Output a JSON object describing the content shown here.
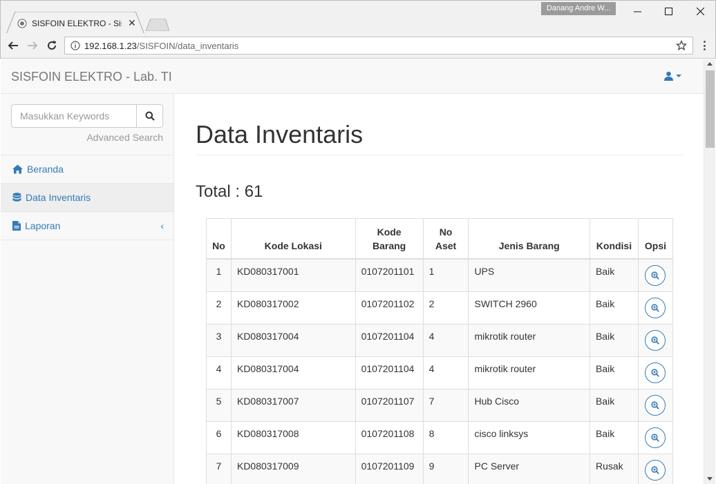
{
  "browser": {
    "tab_title": "SISFOIN ELEKTRO - Sistem",
    "user_badge": "Danang Andre W...",
    "url_host": "192.168.1.23",
    "url_path": "/SISFOIN/data_inventaris"
  },
  "navbar": {
    "brand": "SISFOIN ELEKTRO - Lab. TI"
  },
  "sidebar": {
    "search_placeholder": "Masukkan Keywords",
    "advanced_search": "Advanced Search",
    "items": [
      {
        "label": "Beranda",
        "icon": "home-icon"
      },
      {
        "label": "Data Inventaris",
        "icon": "database-icon"
      },
      {
        "label": "Laporan",
        "icon": "file-icon"
      }
    ]
  },
  "main": {
    "title": "Data Inventaris",
    "total": "Total : 61"
  },
  "table": {
    "headers": [
      "No",
      "Kode Lokasi",
      "Kode Barang",
      "No Aset",
      "Jenis Barang",
      "Kondisi",
      "Opsi"
    ],
    "rows": [
      [
        "1",
        "KD080317001",
        "0107201101",
        "1",
        "UPS",
        "Baik"
      ],
      [
        "2",
        "KD080317002",
        "0107201102",
        "2",
        "SWITCH 2960",
        "Baik"
      ],
      [
        "3",
        "KD080317004",
        "0107201104",
        "4",
        "mikrotik router",
        "Baik"
      ],
      [
        "4",
        "KD080317004",
        "0107201104",
        "4",
        "mikrotik router",
        "Baik"
      ],
      [
        "5",
        "KD080317007",
        "0107201107",
        "7",
        "Hub Cisco",
        "Baik"
      ],
      [
        "6",
        "KD080317008",
        "0107201108",
        "8",
        "cisco linksys",
        "Baik"
      ],
      [
        "7",
        "KD080317009",
        "0107201109",
        "9",
        "PC Server",
        "Rusak"
      ]
    ]
  },
  "colors": {
    "link": "#337ab7",
    "navbar_bg": "#f8f8f8"
  }
}
